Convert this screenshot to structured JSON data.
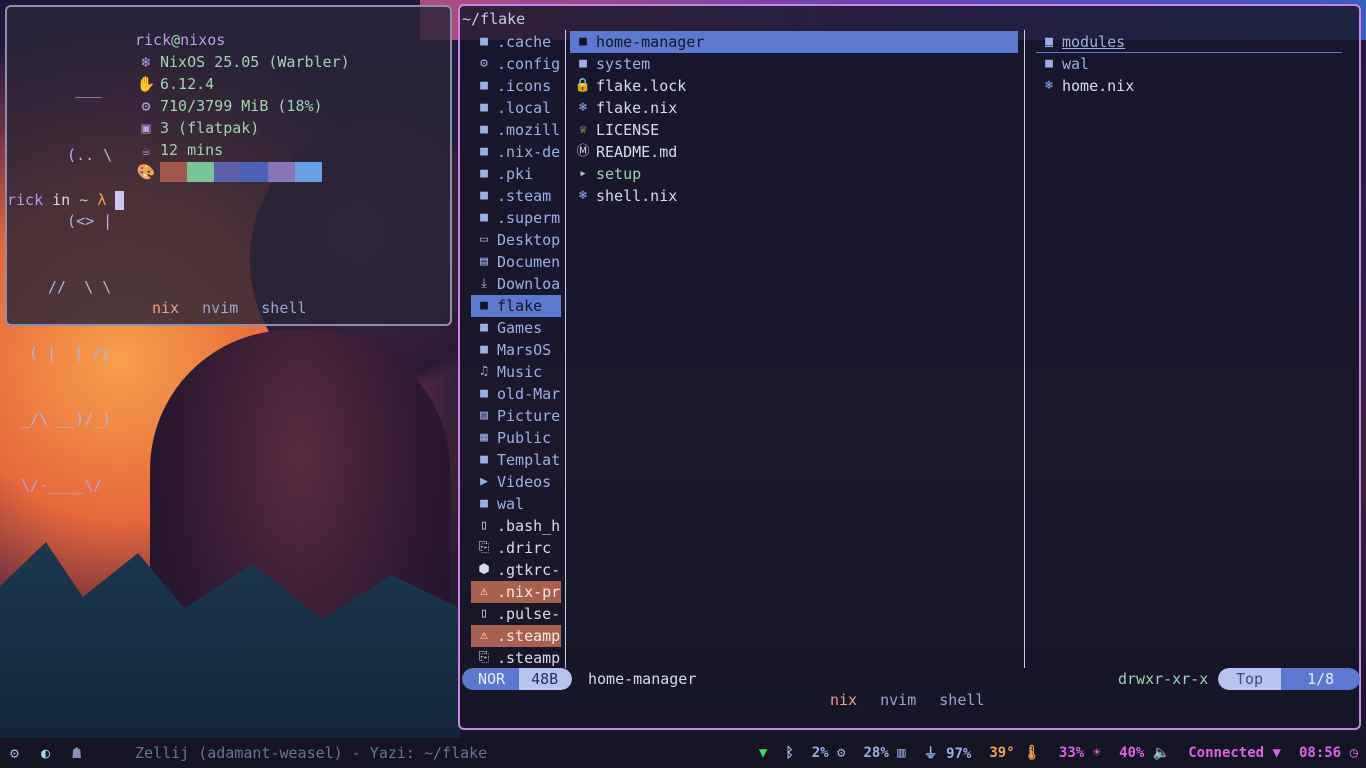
{
  "terminal": {
    "ascii": [
      "  ___",
      "  (.. \\",
      "  (<> |",
      " //  \\ \\",
      "( |  | /|",
      "_/\\ __)/_)",
      "\\/-____\\/"
    ],
    "fetch": {
      "user": "rick",
      "at": "@",
      "host": "nixos",
      "os": "NixOS 25.05 (Warbler)",
      "kernel": "6.12.4",
      "memory": "710/3799 MiB (18%)",
      "packages": "3 (flatpak)",
      "uptime": "12 mins",
      "colors": [
        "#a4584c",
        "#78c496",
        "#5d60a8",
        "#4b62b6",
        "#8a74b8",
        "#6a9ee6"
      ]
    },
    "prompt": {
      "user": "rick",
      "in": "in",
      "dir": "~",
      "symbol": "λ"
    },
    "tabs": [
      "nix",
      "nvim",
      "shell"
    ]
  },
  "yazi": {
    "path": "~/flake",
    "parent": [
      {
        "name": ".cache",
        "icon": "folder-icon"
      },
      {
        "name": ".config",
        "icon": "gear-folder-icon"
      },
      {
        "name": ".icons",
        "icon": "folder-icon"
      },
      {
        "name": ".local",
        "icon": "folder-icon"
      },
      {
        "name": ".mozill",
        "icon": "folder-icon"
      },
      {
        "name": ".nix-de",
        "icon": "folder-icon"
      },
      {
        "name": ".pki",
        "icon": "folder-icon"
      },
      {
        "name": ".steam",
        "icon": "folder-icon"
      },
      {
        "name": ".superm",
        "icon": "folder-icon"
      },
      {
        "name": "Desktop",
        "icon": "monitor-icon"
      },
      {
        "name": "Documen",
        "icon": "document-icon"
      },
      {
        "name": "Downloa",
        "icon": "download-icon"
      },
      {
        "name": "flake",
        "icon": "folder-icon"
      },
      {
        "name": "Games",
        "icon": "folder-icon"
      },
      {
        "name": "MarsOS",
        "icon": "folder-icon"
      },
      {
        "name": "Music",
        "icon": "headphones-icon"
      },
      {
        "name": "old-Mar",
        "icon": "folder-icon"
      },
      {
        "name": "Picture",
        "icon": "image-icon"
      },
      {
        "name": "Public",
        "icon": "building-icon"
      },
      {
        "name": "Templat",
        "icon": "folder-icon"
      },
      {
        "name": "Videos",
        "icon": "video-icon"
      },
      {
        "name": "wal",
        "icon": "folder-icon"
      },
      {
        "name": ".bash_h",
        "icon": "file-icon"
      },
      {
        "name": ".drirc",
        "icon": "config-file-icon"
      },
      {
        "name": ".gtkrc-",
        "icon": "package-icon"
      },
      {
        "name": ".nix-pr",
        "icon": "warning-icon"
      },
      {
        "name": ".pulse-",
        "icon": "file-icon"
      },
      {
        "name": ".steamp",
        "icon": "warning-icon"
      },
      {
        "name": ".steamp",
        "icon": "config-file-icon"
      }
    ],
    "current": [
      {
        "name": "home-manager",
        "icon": "folder-icon"
      },
      {
        "name": "system",
        "icon": "folder-icon"
      },
      {
        "name": "flake.lock",
        "icon": "lock-icon"
      },
      {
        "name": "flake.nix",
        "icon": "nix-icon"
      },
      {
        "name": "LICENSE",
        "icon": "license-icon"
      },
      {
        "name": "README.md",
        "icon": "markdown-icon"
      },
      {
        "name": "setup",
        "icon": "terminal-icon"
      },
      {
        "name": "shell.nix",
        "icon": "nix-icon"
      }
    ],
    "preview": [
      {
        "name": "modules",
        "icon": "folder-icon"
      },
      {
        "name": "wal",
        "icon": "folder-icon"
      },
      {
        "name": "home.nix",
        "icon": "nix-icon"
      }
    ],
    "status": {
      "mode": "NOR",
      "size": "48B",
      "hovered": "home-manager",
      "permissions": "drwxr-xr-x",
      "position": "Top",
      "count": "1/8"
    },
    "tabs": [
      "nix",
      "nvim",
      "shell"
    ]
  },
  "bar": {
    "window_title": "Zellij (adamant-weasel) - Yazi: ~/flake",
    "cpu": "2%",
    "memory": "28%",
    "battery": "97%",
    "temp": "39°",
    "brightness": "33%",
    "volume": "40%",
    "network": "Connected",
    "clock": "08:56"
  }
}
